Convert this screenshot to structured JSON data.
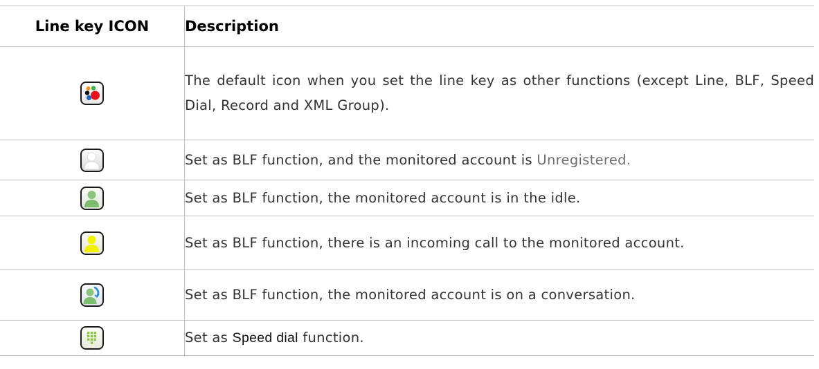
{
  "table": {
    "headers": {
      "icon": "Line key ICON",
      "description": "Description"
    },
    "rows": [
      {
        "icon": "default-function-icon",
        "description": "The default icon when you set the line key as other functions (except Line, BLF, Speed Dial, Record and XML Group)."
      },
      {
        "icon": "blf-unregistered-icon",
        "description_prefix": "Set as BLF function, and the monitored account is ",
        "description_highlight": "Unregistered.",
        "description_suffix": ""
      },
      {
        "icon": "blf-idle-icon",
        "description": "Set as BLF function, the monitored account is in the idle."
      },
      {
        "icon": "blf-incoming-call-icon",
        "description": "Set as BLF function, there is an incoming call to the monitored account."
      },
      {
        "icon": "blf-conversation-icon",
        "description": "Set as BLF function, the monitored account is on a conversation."
      },
      {
        "icon": "speed-dial-icon",
        "description_prefix": "Set as ",
        "description_highlight": "Speed dial",
        "description_suffix": " function."
      }
    ]
  },
  "colors": {
    "grid_border": "#bfbfbf",
    "text": "#333333",
    "muted_text": "#6e6e6e",
    "header_text": "#000000",
    "icon_border": "#1a1a1a",
    "person_white": "#ffffff",
    "person_green": "#7dbd6e",
    "person_yellow": "#f2f200",
    "talk_arrow": "#2c8fd6",
    "dial_green": "#8cc63f",
    "dot_red": "#e8141c",
    "dot_blue": "#1d66c2",
    "dot_green": "#39b54a",
    "dot_orange": "#f7941d",
    "dot_black": "#111111"
  }
}
